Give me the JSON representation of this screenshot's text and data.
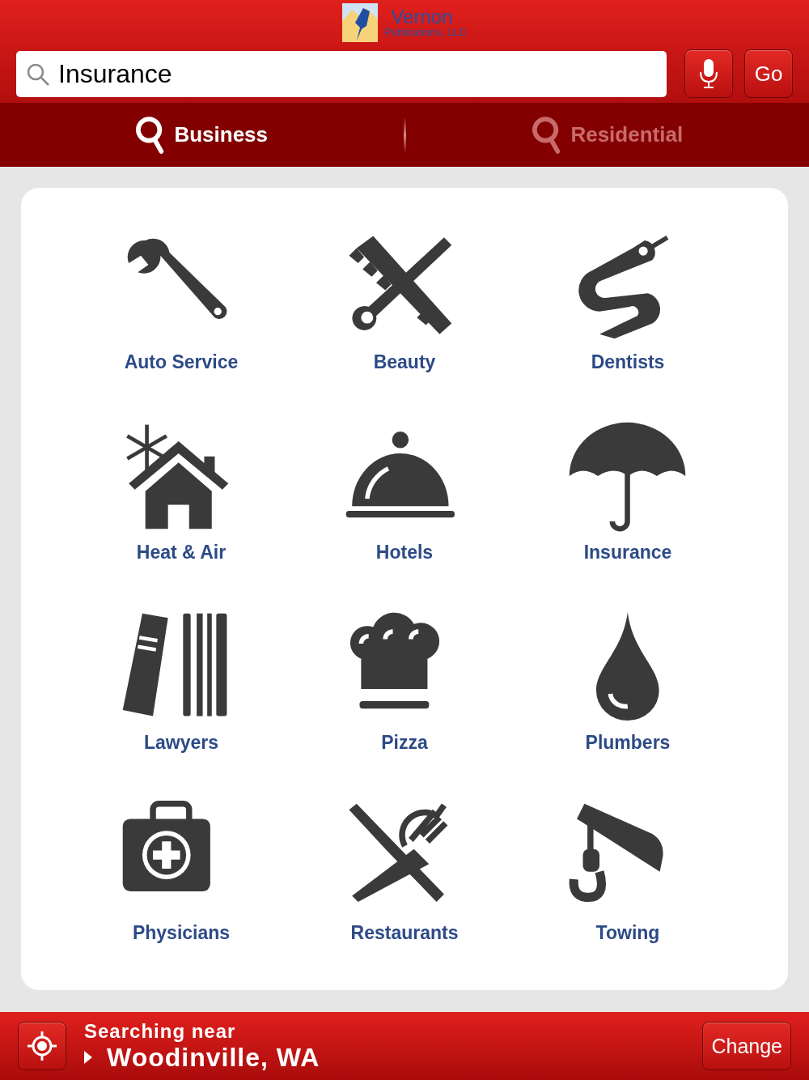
{
  "logo": {
    "name": "Vernon",
    "subtitle": "Publications, LLC"
  },
  "search": {
    "value": "Insurance"
  },
  "go_button": "Go",
  "tabs": [
    {
      "label": "Business",
      "selected": true
    },
    {
      "label": "Residential",
      "selected": false
    }
  ],
  "categories": [
    {
      "label": "Auto Service",
      "kind": "wrench"
    },
    {
      "label": "Beauty",
      "kind": "comb"
    },
    {
      "label": "Dentists",
      "kind": "dental"
    },
    {
      "label": "Heat & Air",
      "kind": "house"
    },
    {
      "label": "Hotels",
      "kind": "cloche"
    },
    {
      "label": "Insurance",
      "kind": "umbrella"
    },
    {
      "label": "Lawyers",
      "kind": "books"
    },
    {
      "label": "Pizza",
      "kind": "chef"
    },
    {
      "label": "Plumbers",
      "kind": "drop"
    },
    {
      "label": "Physicians",
      "kind": "medkit"
    },
    {
      "label": "Restaurants",
      "kind": "cutlery"
    },
    {
      "label": "Towing",
      "kind": "tow"
    }
  ],
  "location": {
    "caption": "Searching near",
    "place": "Woodinville, WA",
    "change_button": "Change"
  }
}
